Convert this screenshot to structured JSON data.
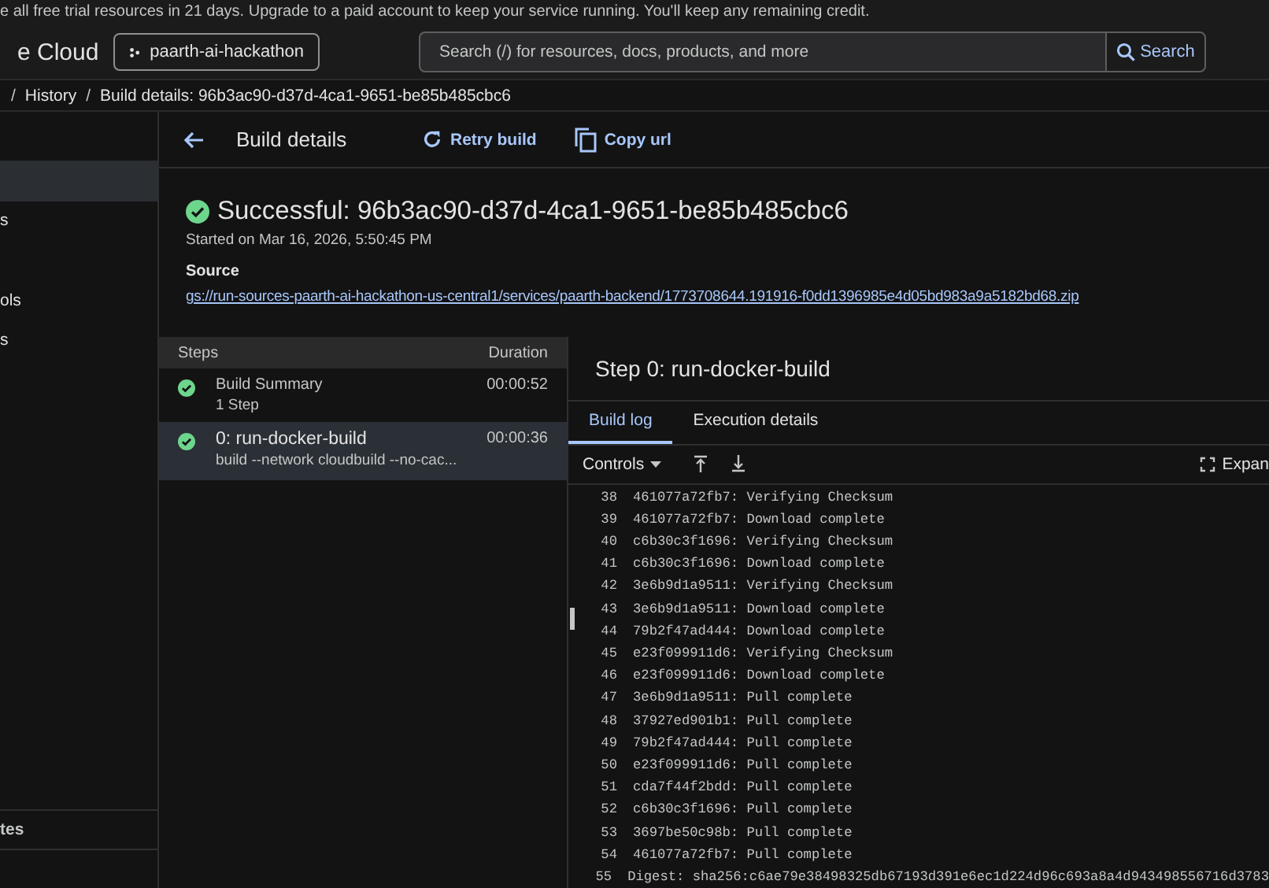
{
  "banner": {
    "text": "e all free trial resources in 21 days. Upgrade to a paid account to keep your service running. You'll keep any remaining credit."
  },
  "header": {
    "logo_text": "e Cloud",
    "project": "paarth-ai-hackathon",
    "search": {
      "placeholder": "Search (/) for resources, docs, products, and more",
      "button": "Search"
    }
  },
  "breadcrumb": [
    {
      "separator": "/",
      "label": "History"
    },
    {
      "separator": "/",
      "label": "Build details: 96b3ac90-d37d-4ca1-9651-be85b485cbc6"
    }
  ],
  "sidebar": {
    "items": [
      {
        "selected": true
      },
      {
        "label": "s",
        "selected": false
      },
      {
        "label": "ols",
        "selected": false
      },
      {
        "label": "s",
        "selected": false
      }
    ],
    "footer_item": "tes"
  },
  "page_header": {
    "title": "Build details",
    "actions": [
      {
        "kind": "retry",
        "label": "Retry build"
      },
      {
        "kind": "copy",
        "label": "Copy url"
      }
    ]
  },
  "build": {
    "status": "Successful: 96b3ac90-d37d-4ca1-9651-be85b485cbc6",
    "started": "Started on Mar 16, 2026, 5:50:45 PM",
    "source_label": "Source",
    "source_link": "gs://run-sources-paarth-ai-hackathon-us-central1/services/paarth-backend/1773708644.191916-f0dd1396985e4d05bd983a9a5182bd68.zip"
  },
  "steps": {
    "columns": [
      "Steps",
      "Duration"
    ],
    "rows": [
      {
        "title": "Build Summary",
        "subtitle": "1 Step",
        "duration": "00:00:52",
        "selected": false
      },
      {
        "title": "0: run-docker-build",
        "subtitle": "build --network cloudbuild --no-cac...",
        "duration": "00:00:36",
        "selected": true
      }
    ]
  },
  "step_panel": {
    "title": "Step 0: run-docker-build",
    "tabs": [
      {
        "label": "Build log",
        "selected": true
      },
      {
        "label": "Execution details",
        "selected": false
      }
    ],
    "controls": "Controls",
    "expand": "Expan",
    "log": [
      {
        "n": "38",
        "text": "461077a72fb7: Verifying Checksum"
      },
      {
        "n": "39",
        "text": "461077a72fb7: Download complete"
      },
      {
        "n": "40",
        "text": "c6b30c3f1696: Verifying Checksum"
      },
      {
        "n": "41",
        "text": "c6b30c3f1696: Download complete"
      },
      {
        "n": "42",
        "text": "3e6b9d1a9511: Verifying Checksum"
      },
      {
        "n": "43",
        "text": "3e6b9d1a9511: Download complete"
      },
      {
        "n": "44",
        "text": "79b2f47ad444: Download complete"
      },
      {
        "n": "45",
        "text": "e23f099911d6: Verifying Checksum"
      },
      {
        "n": "46",
        "text": "e23f099911d6: Download complete"
      },
      {
        "n": "47",
        "text": "3e6b9d1a9511: Pull complete"
      },
      {
        "n": "48",
        "text": "37927ed901b1: Pull complete"
      },
      {
        "n": "49",
        "text": "79b2f47ad444: Pull complete"
      },
      {
        "n": "50",
        "text": "e23f099911d6: Pull complete"
      },
      {
        "n": "51",
        "text": "cda7f44f2bdd: Pull complete"
      },
      {
        "n": "52",
        "text": "c6b30c3f1696: Pull complete"
      },
      {
        "n": "53",
        "text": "3697be50c98b: Pull complete"
      },
      {
        "n": "54",
        "text": "461077a72fb7: Pull complete"
      },
      {
        "n": "55",
        "text": "Digest: sha256:c6ae79e38498325db67193d391e6ec1d224d96c693a8a4d943498556716d3783"
      }
    ]
  }
}
